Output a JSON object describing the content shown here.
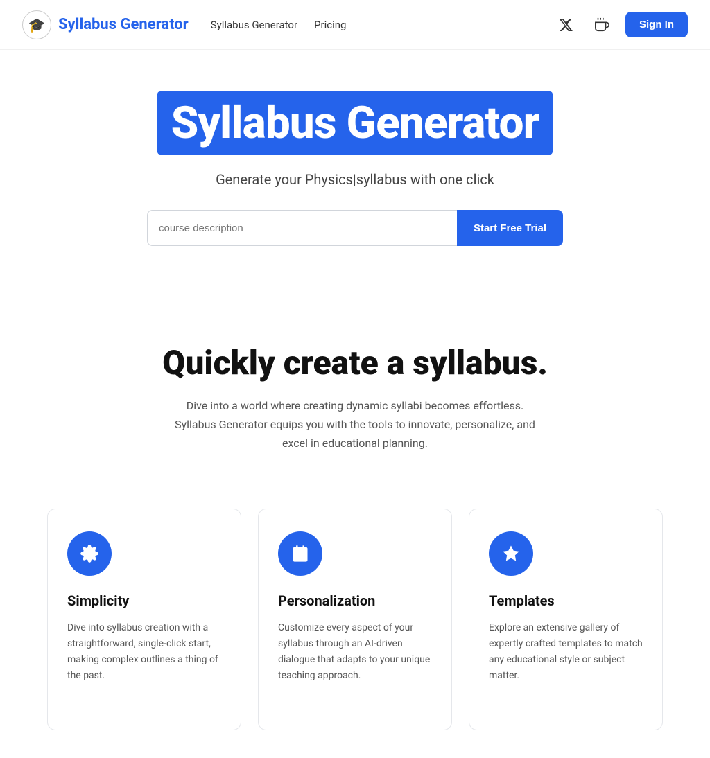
{
  "navbar": {
    "logo_text": "Syllabus Generator",
    "logo_icon": "🎓",
    "nav_links": [
      {
        "label": "Syllabus Generator",
        "id": "nav-syllabus"
      },
      {
        "label": "Pricing",
        "id": "nav-pricing"
      }
    ],
    "sign_in_label": "Sign In"
  },
  "hero": {
    "title": "Syllabus Generator",
    "subtitle": "Generate your Physics|syllabus with one click",
    "input_placeholder": "course description",
    "cta_label": "Start Free Trial"
  },
  "quickly_section": {
    "title": "Quickly create a syllabus.",
    "description": "Dive into a world where creating dynamic syllabi becomes effortless. Syllabus Generator equips you with the tools to innovate, personalize, and excel in educational planning."
  },
  "cards": [
    {
      "id": "simplicity",
      "title": "Simplicity",
      "description": "Dive into syllabus creation with a straightforward, single-click start, making complex outlines a thing of the past.",
      "icon": "gear"
    },
    {
      "id": "personalization",
      "title": "Personalization",
      "description": "Customize every aspect of your syllabus through an AI-driven dialogue that adapts to your unique teaching approach.",
      "icon": "calendar"
    },
    {
      "id": "templates",
      "title": "Templates",
      "description": "Explore an extensive gallery of expertly crafted templates to match any educational style or subject matter.",
      "icon": "star"
    }
  ]
}
